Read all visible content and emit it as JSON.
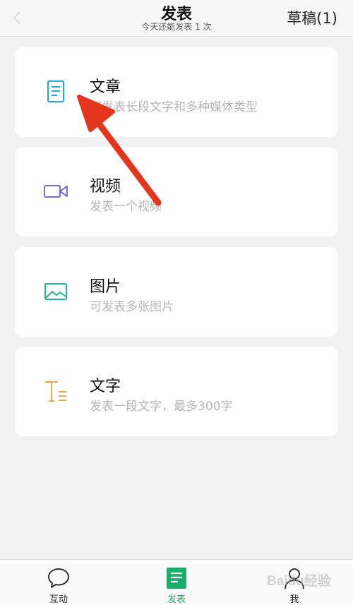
{
  "header": {
    "title": "发表",
    "subtitle": "今天还能发表 1 次",
    "drafts_label": "草稿(1)"
  },
  "options": [
    {
      "title": "文章",
      "description": "可发表长段文字和多种媒体类型",
      "icon": "article-icon",
      "color": "#1ea7e8"
    },
    {
      "title": "视频",
      "description": "发表一个视频",
      "icon": "video-icon",
      "color": "#6b6fd6"
    },
    {
      "title": "图片",
      "description": "可发表多张图片",
      "icon": "image-icon",
      "color": "#1fb888"
    },
    {
      "title": "文字",
      "description": "发表一段文字，最多300字",
      "icon": "text-icon",
      "color": "#f0a54a"
    }
  ],
  "tabbar": {
    "items": [
      {
        "label": "互动",
        "icon": "chat-bubble-icon",
        "active": false
      },
      {
        "label": "发表",
        "icon": "publish-icon",
        "active": true
      },
      {
        "label": "我",
        "icon": "person-icon",
        "active": false
      }
    ]
  },
  "colors": {
    "accent": "#1aad6b",
    "annotation_arrow": "#e3361e"
  },
  "watermark": {
    "text": "Baidu经验"
  }
}
